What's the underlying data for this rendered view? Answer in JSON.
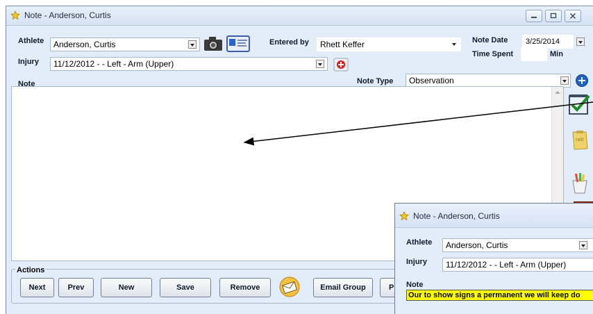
{
  "window": {
    "title": "Note - Anderson, Curtis"
  },
  "form": {
    "athlete_label": "Athlete",
    "athlete_value": "Anderson, Curtis",
    "injury_label": "Injury",
    "injury_value": "11/12/2012 -  - Left - Arm (Upper)",
    "entered_by_label": "Entered by",
    "entered_by_value": "Rhett Keffer",
    "note_date_label": "Note Date",
    "note_date_value": "3/25/2014",
    "time_spent_label": "Time Spent",
    "time_spent_value": "",
    "time_unit": "Min",
    "note_type_label": "Note Type",
    "note_type_value": "Observation",
    "note_label": "Note"
  },
  "actions": {
    "group_label": "Actions",
    "buttons": [
      "Next",
      "Prev",
      "New",
      "Save",
      "Remove",
      "Email Group",
      "Pi"
    ]
  },
  "popup": {
    "title": "Note - Anderson, Curtis",
    "athlete_label": "Athlete",
    "athlete_value": "Anderson, Curtis",
    "injury_label": "Injury",
    "injury_value": "11/12/2012 -  - Left - Arm (Upper)",
    "note_label": "Note",
    "note_text": "Our to show signs a permanent we will keep do"
  },
  "colors": {
    "highlight": "#ffff00",
    "window_bg": "#e3edf9",
    "accent_blue": "#1f63c6",
    "add_red": "#d61e1e"
  }
}
